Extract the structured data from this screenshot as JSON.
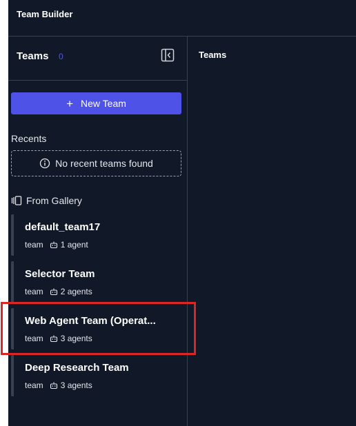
{
  "app": {
    "title": "Team Builder"
  },
  "sidebar": {
    "heading": "Teams",
    "count": "0",
    "new_team_label": "New Team",
    "recents_label": "Recents",
    "recents_empty": "No recent teams found",
    "gallery_label": "From Gallery",
    "teams": [
      {
        "name": "default_team17",
        "type": "team",
        "agents": "1 agent"
      },
      {
        "name": "Selector Team",
        "type": "team",
        "agents": "2 agents"
      },
      {
        "name": "Web Agent Team (Operat...",
        "type": "team",
        "agents": "3 agents"
      },
      {
        "name": "Deep Research Team",
        "type": "team",
        "agents": "3 agents"
      }
    ]
  },
  "main": {
    "title": "Teams"
  },
  "colors": {
    "background": "#111827",
    "accent": "#4f52e6",
    "highlight": "#dc2626",
    "border": "#374151"
  }
}
